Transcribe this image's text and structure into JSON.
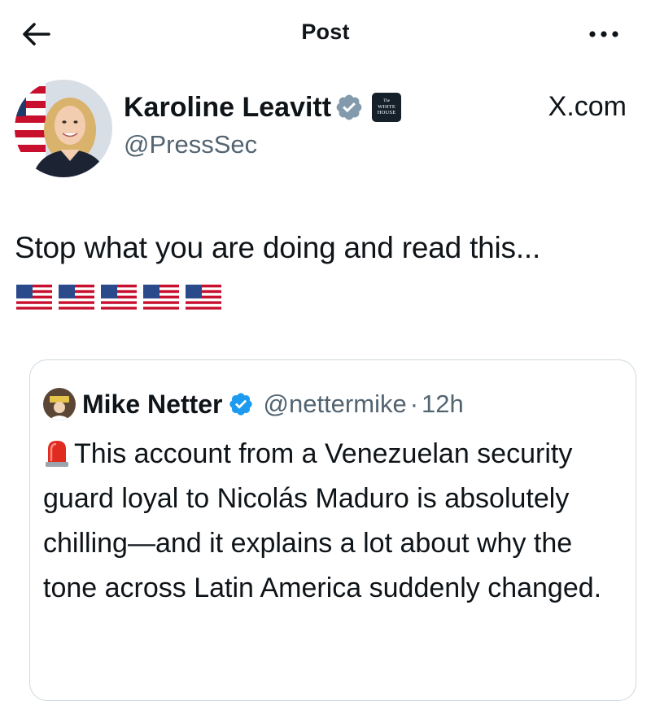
{
  "header": {
    "title": "Post",
    "back_icon": "arrow-left-icon",
    "more_icon": "more-horizontal-icon"
  },
  "author": {
    "name": "Karoline Leavitt",
    "handle": "@PressSec",
    "verified": "grey-verified-badge",
    "affiliation_badge": {
      "line1": "The",
      "line2": "WHITE",
      "line3": "HOUSE"
    },
    "source_label": "X.com"
  },
  "post": {
    "text": "Stop what you are doing and read this...",
    "emoji": [
      "us-flag",
      "us-flag",
      "us-flag",
      "us-flag",
      "us-flag"
    ]
  },
  "quote": {
    "name": "Mike Netter",
    "handle": "@nettermike",
    "separator": "·",
    "time": "12h",
    "verified": "blue-verified-badge",
    "lead_icon": "police-siren-icon",
    "text": "This account from a Venezuelan security guard loyal to Nicolás Maduro is absolutely chilling—and it explains a lot about why the tone across Latin America suddenly changed."
  },
  "colors": {
    "text_primary": "#0f1419",
    "text_secondary": "#536471",
    "border": "#cfd9de",
    "verified_blue": "#1d9bf0",
    "verified_grey": "#829aab"
  }
}
